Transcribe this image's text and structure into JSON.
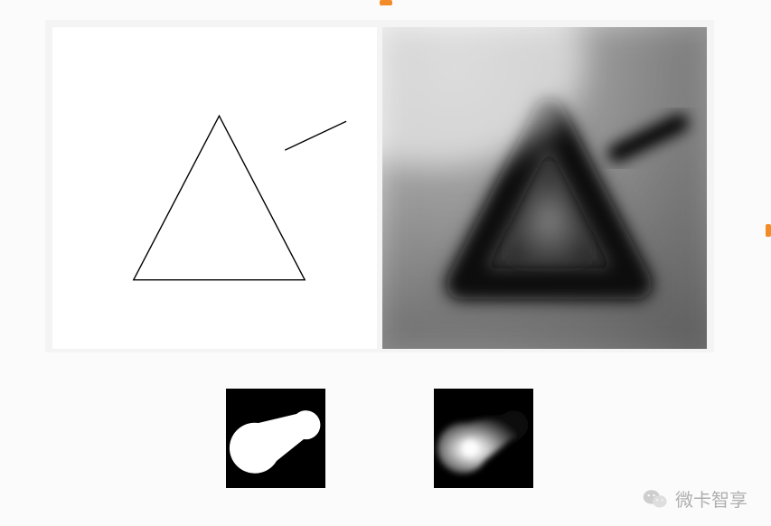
{
  "watermark": {
    "text": "微卡智享"
  },
  "icons": {
    "wechat": "wechat-icon"
  },
  "figures": {
    "left_panel": "triangle-outline-with-line",
    "right_panel": "triangle-distance-transform",
    "thumb_left": "pill-shape-binary",
    "thumb_right": "pill-shape-distance-transform"
  }
}
